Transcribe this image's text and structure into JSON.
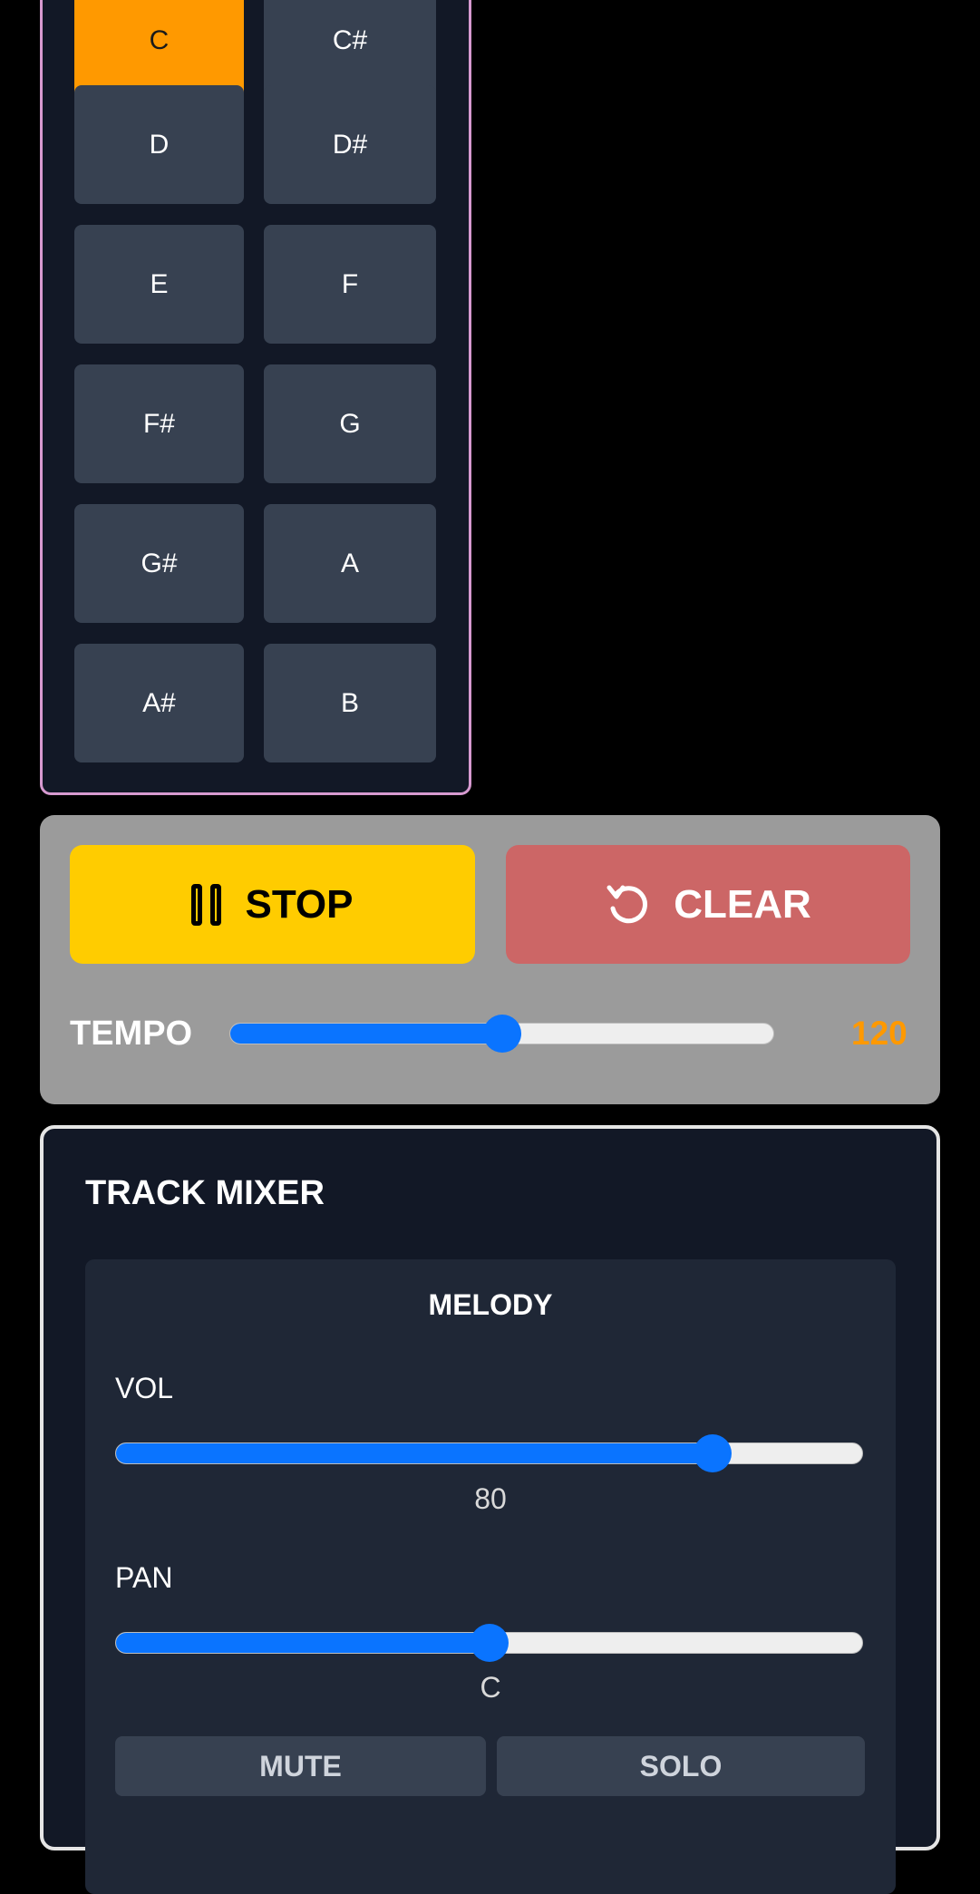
{
  "notes": {
    "keys": [
      {
        "label": "C",
        "active": true
      },
      {
        "label": "C#",
        "active": false
      },
      {
        "label": "D",
        "active": false
      },
      {
        "label": "D#",
        "active": false
      },
      {
        "label": "E",
        "active": false
      },
      {
        "label": "F",
        "active": false
      },
      {
        "label": "F#",
        "active": false
      },
      {
        "label": "G",
        "active": false
      },
      {
        "label": "G#",
        "active": false
      },
      {
        "label": "A",
        "active": false
      },
      {
        "label": "A#",
        "active": false
      },
      {
        "label": "B",
        "active": false
      }
    ]
  },
  "transport": {
    "stop_label": "STOP",
    "clear_label": "CLEAR",
    "tempo_label": "TEMPO",
    "tempo_value": "120",
    "tempo_fraction": 0.5
  },
  "mixer": {
    "title": "TRACK MIXER",
    "track": {
      "name": "MELODY",
      "vol_label": "VOL",
      "vol_value": "80",
      "vol_fraction": 0.8,
      "pan_label": "PAN",
      "pan_value": "C",
      "pan_fraction": 0.5,
      "mute_label": "MUTE",
      "solo_label": "SOLO"
    }
  },
  "colors": {
    "accent_orange": "#ff9900",
    "stop_yellow": "#ffcc00",
    "clear_red": "#cc6666",
    "slider_blue": "#0a74ff"
  }
}
